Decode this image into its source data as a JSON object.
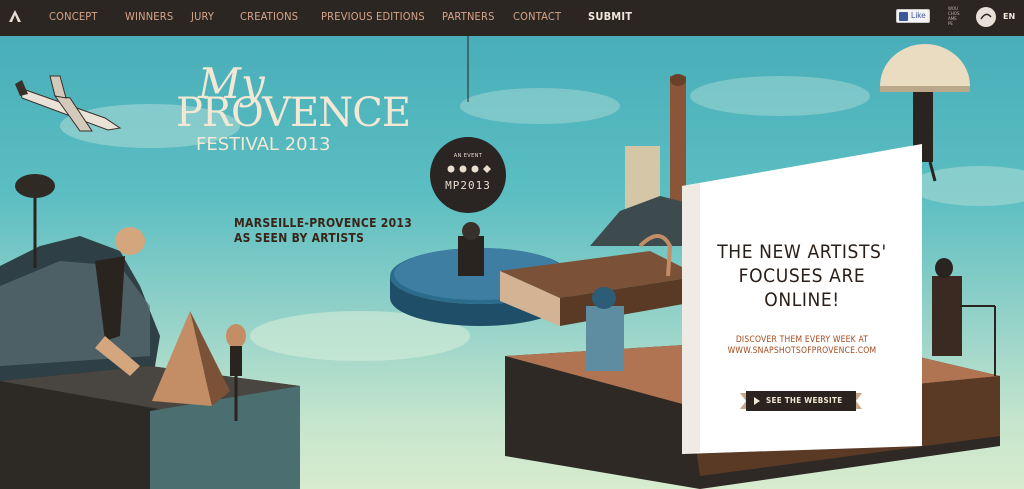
{
  "nav": {
    "items": [
      {
        "label": "CONCEPT"
      },
      {
        "label": "WINNERS"
      },
      {
        "label": "JURY"
      },
      {
        "label": "CREATIONS"
      },
      {
        "label": "PREVIOUS EDITIONS"
      },
      {
        "label": "PARTNERS"
      },
      {
        "label": "CONTACT"
      }
    ],
    "submit_label": "SUBMIT",
    "like_label": "Like",
    "mini_logo_lines": [
      "WOU",
      "CHOS",
      "AME",
      "PE"
    ],
    "language": "EN"
  },
  "hero": {
    "title_line1": "My",
    "title_line2": "PROVENCE",
    "title_line3": "FESTIVAL 2013",
    "subtitle_line1": "MARSEILLE-PROVENCE 2013",
    "subtitle_line2": "AS SEEN BY ARTISTS"
  },
  "badge": {
    "event_label": "AN EVENT",
    "name": "MP2013"
  },
  "card": {
    "headline_line1": "THE NEW ARTISTS'",
    "headline_line2": "FOCUSES ARE",
    "headline_line3": "ONLINE!",
    "desc_line1": "DISCOVER THEM EVERY WEEK AT",
    "desc_line2": "WWW.SNAPSHOTSOFPROVENCE.COM",
    "button_label": "SEE THE WEBSITE"
  },
  "icons": {
    "logo": "triangle-logo-icon",
    "facebook": "facebook-icon",
    "play": "play-icon"
  },
  "colors": {
    "nav_bg": "#2c2622",
    "nav_text": "#d8a58a",
    "sky_top": "#49aeb9",
    "title_cream": "#f3e8d4",
    "card_headline": "#2a1e18",
    "card_desc": "#a24a1e",
    "button_bg": "#2a2320"
  }
}
